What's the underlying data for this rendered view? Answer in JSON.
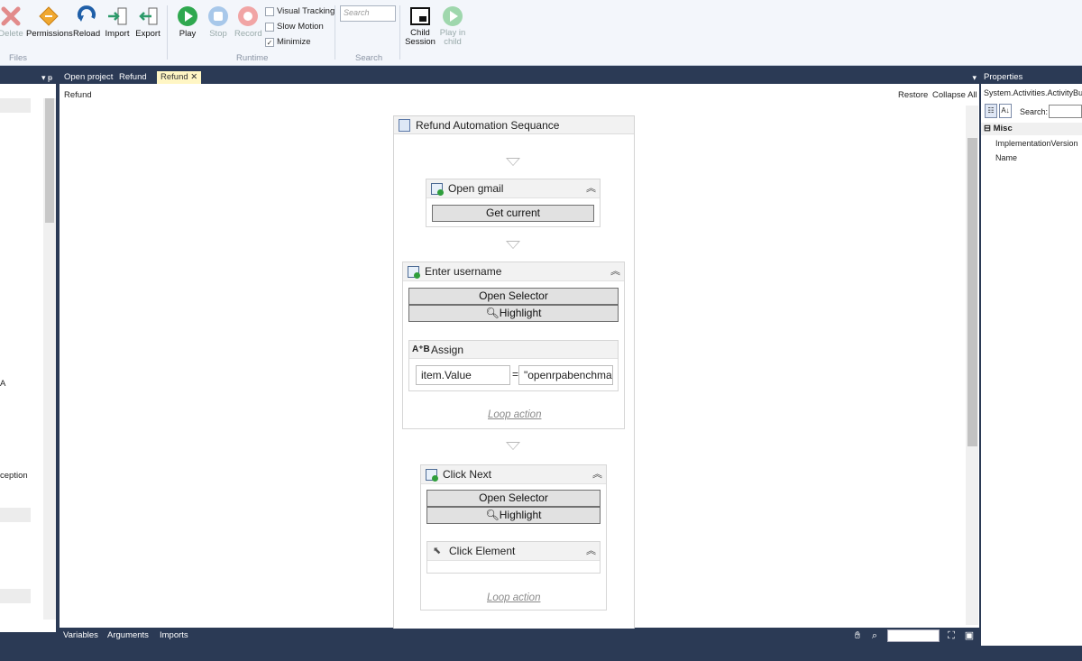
{
  "ribbon": {
    "files": {
      "delete": "Delete",
      "permissions": "Permissions",
      "reload": "Reload",
      "import": "Import",
      "export": "Export",
      "group": "Files"
    },
    "runtime": {
      "play": "Play",
      "stop": "Stop",
      "record": "Record",
      "visual_tracking": "Visual Tracking",
      "slow_motion": "Slow Motion",
      "minimize": "Minimize",
      "group": "Runtime"
    },
    "search": {
      "placeholder": "Search",
      "group": "Search"
    },
    "child": {
      "child_session": "Child Session",
      "play_in_child": "Play in child"
    }
  },
  "left_panel": {
    "items": [
      "A",
      "ception"
    ]
  },
  "tabs": [
    "Open project",
    "Refund",
    "Refund"
  ],
  "designer": {
    "breadcrumb": "Refund",
    "restore": "Restore",
    "collapse_all": "Collapse All",
    "sequence_title": "Refund Automation Sequance",
    "activities": {
      "open_gmail": {
        "title": "Open gmail",
        "button": "Get current"
      },
      "enter_username": {
        "title": "Enter username",
        "open_selector": "Open Selector",
        "highlight": "Highlight",
        "assign_title": "Assign",
        "assign_left": "item.Value",
        "assign_eq": "=",
        "assign_right": "\"openrpabenchma",
        "loop": "Loop action"
      },
      "click_next": {
        "title": "Click Next",
        "open_selector": "Open Selector",
        "highlight": "Highlight",
        "click_element": "Click Element",
        "loop": "Loop action"
      }
    }
  },
  "bottom": {
    "variables": "Variables",
    "arguments": "Arguments",
    "imports": "Imports"
  },
  "properties": {
    "header": "Properties",
    "type": "System.Activities.ActivityBu",
    "search_label": "Search:",
    "category": "Misc",
    "rows": [
      "ImplementationVersion",
      "Name"
    ]
  }
}
